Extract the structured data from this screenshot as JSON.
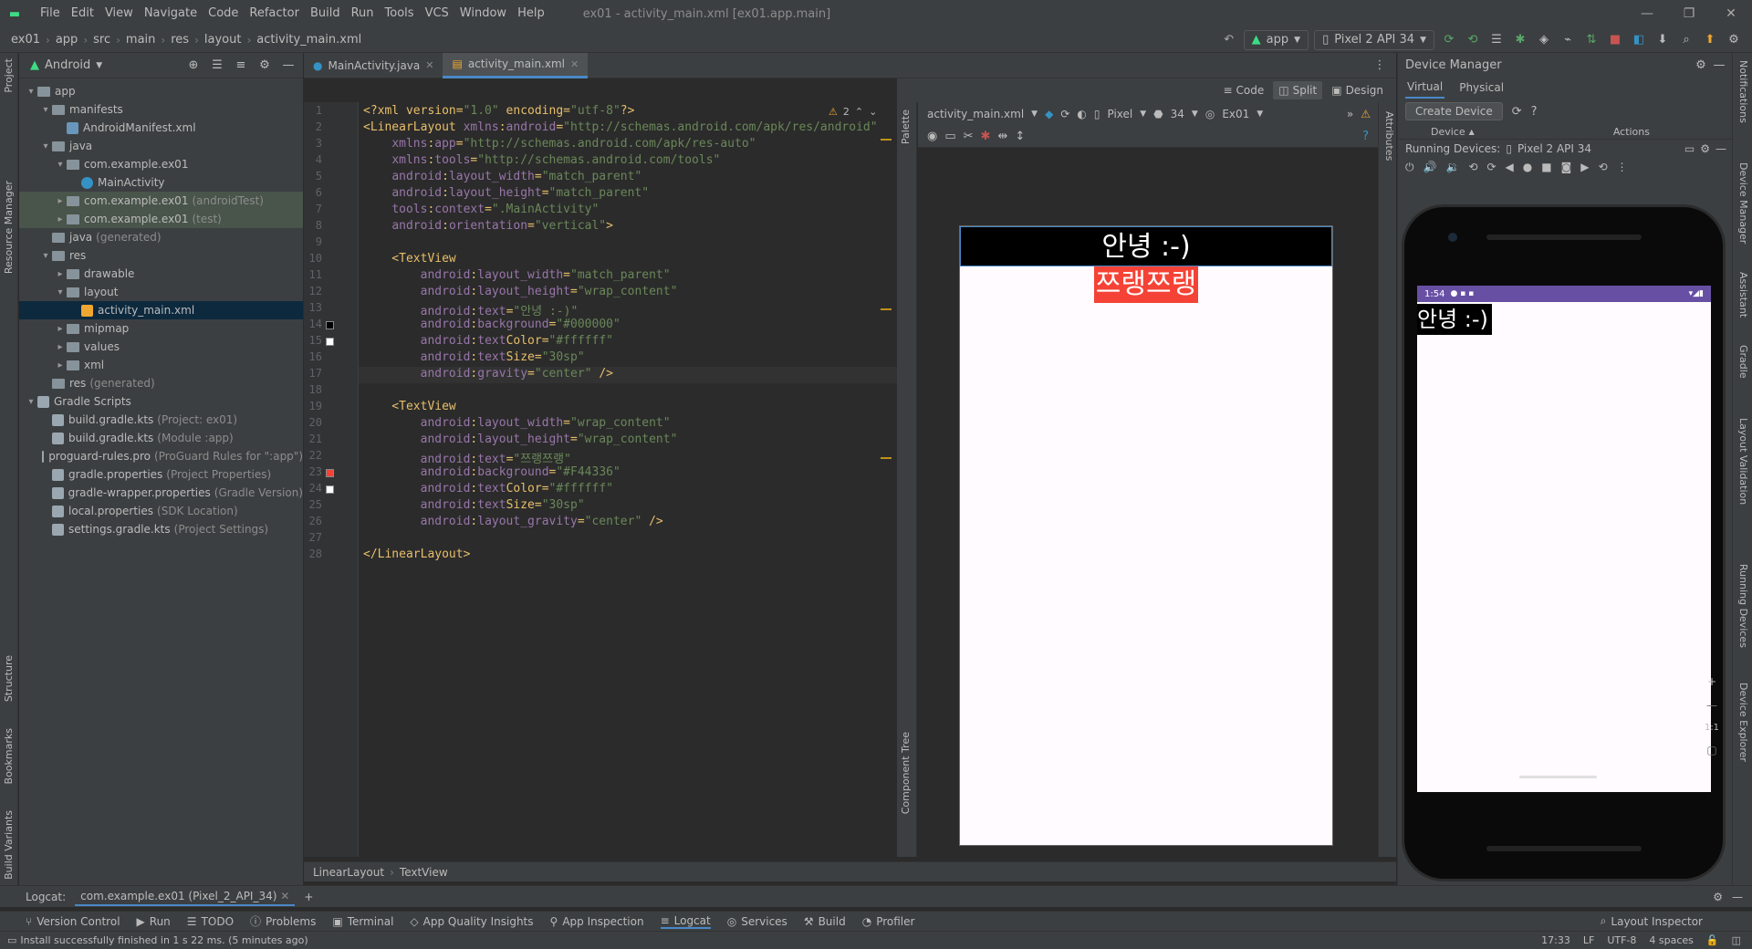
{
  "menubar": {
    "items": [
      "File",
      "Edit",
      "View",
      "Navigate",
      "Code",
      "Refactor",
      "Build",
      "Run",
      "Tools",
      "VCS",
      "Window",
      "Help"
    ],
    "title": "ex01 - activity_main.xml [ex01.app.main]"
  },
  "navbar": {
    "crumbs": [
      "ex01",
      "app",
      "src",
      "main",
      "res",
      "layout",
      "activity_main.xml"
    ],
    "run_config": "app",
    "device": "Pixel 2 API 34"
  },
  "project": {
    "view": "Android",
    "tree": [
      {
        "label": "app",
        "extra": "",
        "indent": 0,
        "kind": "folder",
        "arrow": "▾"
      },
      {
        "label": "manifests",
        "extra": "",
        "indent": 1,
        "kind": "folder",
        "arrow": "▾"
      },
      {
        "label": "AndroidManifest.xml",
        "extra": "",
        "indent": 2,
        "kind": "manifest",
        "arrow": ""
      },
      {
        "label": "java",
        "extra": "",
        "indent": 1,
        "kind": "folder",
        "arrow": "▾"
      },
      {
        "label": "com.example.ex01",
        "extra": "",
        "indent": 2,
        "kind": "folder",
        "arrow": "▾"
      },
      {
        "label": "MainActivity",
        "extra": "",
        "indent": 3,
        "kind": "class",
        "arrow": ""
      },
      {
        "label": "com.example.ex01",
        "extra": "(androidTest)",
        "indent": 2,
        "kind": "folder",
        "arrow": "▸",
        "hl": true
      },
      {
        "label": "com.example.ex01",
        "extra": "(test)",
        "indent": 2,
        "kind": "folder",
        "arrow": "▸",
        "hl": true
      },
      {
        "label": "java",
        "extra": "(generated)",
        "indent": 1,
        "kind": "folder",
        "arrow": ""
      },
      {
        "label": "res",
        "extra": "",
        "indent": 1,
        "kind": "folder",
        "arrow": "▾"
      },
      {
        "label": "drawable",
        "extra": "",
        "indent": 2,
        "kind": "folder",
        "arrow": "▸"
      },
      {
        "label": "layout",
        "extra": "",
        "indent": 2,
        "kind": "folder",
        "arrow": "▾"
      },
      {
        "label": "activity_main.xml",
        "extra": "",
        "indent": 3,
        "kind": "layoutfile",
        "arrow": "",
        "selected": true
      },
      {
        "label": "mipmap",
        "extra": "",
        "indent": 2,
        "kind": "folder",
        "arrow": "▸"
      },
      {
        "label": "values",
        "extra": "",
        "indent": 2,
        "kind": "folder",
        "arrow": "▸"
      },
      {
        "label": "xml",
        "extra": "",
        "indent": 2,
        "kind": "folder",
        "arrow": "▸"
      },
      {
        "label": "res",
        "extra": "(generated)",
        "indent": 1,
        "kind": "folder",
        "arrow": ""
      },
      {
        "label": "Gradle Scripts",
        "extra": "",
        "indent": 0,
        "kind": "gradle",
        "arrow": "▾"
      },
      {
        "label": "build.gradle.kts",
        "extra": "(Project: ex01)",
        "indent": 1,
        "kind": "gradle",
        "arrow": ""
      },
      {
        "label": "build.gradle.kts",
        "extra": "(Module :app)",
        "indent": 1,
        "kind": "gradle",
        "arrow": ""
      },
      {
        "label": "proguard-rules.pro",
        "extra": "(ProGuard Rules for \":app\")",
        "indent": 1,
        "kind": "file",
        "arrow": ""
      },
      {
        "label": "gradle.properties",
        "extra": "(Project Properties)",
        "indent": 1,
        "kind": "file",
        "arrow": ""
      },
      {
        "label": "gradle-wrapper.properties",
        "extra": "(Gradle Version)",
        "indent": 1,
        "kind": "file",
        "arrow": ""
      },
      {
        "label": "local.properties",
        "extra": "(SDK Location)",
        "indent": 1,
        "kind": "file",
        "arrow": ""
      },
      {
        "label": "settings.gradle.kts",
        "extra": "(Project Settings)",
        "indent": 1,
        "kind": "gradle",
        "arrow": ""
      }
    ]
  },
  "left_strip": [
    "Project",
    "Resource Manager",
    "Structure",
    "Bookmarks",
    "Build Variants"
  ],
  "right_strip": [
    "Notifications",
    "Device Manager",
    "Assistant",
    "Gradle",
    "Layout Validation",
    "Running Devices",
    "Device Explorer"
  ],
  "editor": {
    "tabs": [
      {
        "label": "MainActivity.java",
        "active": false
      },
      {
        "label": "activity_main.xml",
        "active": true
      }
    ],
    "warnings": "2",
    "lines": [
      "<?xml version=\"1.0\" encoding=\"utf-8\"?>",
      "<LinearLayout xmlns:android=\"http://schemas.android.com/apk/res/android\"",
      "    xmlns:app=\"http://schemas.android.com/apk/res-auto\"",
      "    xmlns:tools=\"http://schemas.android.com/tools\"",
      "    android:layout_width=\"match_parent\"",
      "    android:layout_height=\"match_parent\"",
      "    tools:context=\".MainActivity\"",
      "    android:orientation=\"vertical\">",
      "",
      "    <TextView",
      "        android:layout_width=\"match_parent\"",
      "        android:layout_height=\"wrap_content\"",
      "        android:text=\"안녕 :-)\"",
      "        android:background=\"#000000\"",
      "        android:textColor=\"#ffffff\"",
      "        android:textSize=\"30sp\"",
      "        android:gravity=\"center\" />",
      "",
      "    <TextView",
      "        android:layout_width=\"wrap_content\"",
      "        android:layout_height=\"wrap_content\"",
      "        android:text=\"쯔랭쯔랭\"",
      "        android:background=\"#F44336\"",
      "        android:textColor=\"#ffffff\"",
      "        android:textSize=\"30sp\"",
      "        android:layout_gravity=\"center\" />",
      "",
      "</LinearLayout>"
    ],
    "current_line": 17,
    "color_swatches": [
      {
        "line": 14,
        "color": "#000000"
      },
      {
        "line": 15,
        "color": "#ffffff"
      },
      {
        "line": 23,
        "color": "#F44336"
      },
      {
        "line": 24,
        "color": "#ffffff"
      }
    ]
  },
  "view_modes": [
    "Code",
    "Split",
    "Design"
  ],
  "design": {
    "file": "activity_main.xml",
    "device": "Pixel",
    "api": "34",
    "theme": "Ex01",
    "palette_label": "Palette",
    "component_tree_label": "Component Tree",
    "attributes_label": "Attributes",
    "tv1_text": "안녕 :-)",
    "tv2_text": "쯔랭쯔랭"
  },
  "device_manager": {
    "title": "Device Manager",
    "tabs": [
      "Virtual",
      "Physical"
    ],
    "create_button": "Create Device",
    "col_device": "Device",
    "col_actions": "Actions",
    "running_label": "Running Devices:",
    "running_device": "Pixel 2 API 34",
    "emu_time": "1:54",
    "emu_text": "안녕 :-)",
    "zoom_label": "1:1"
  },
  "breadcrumbs": [
    "LinearLayout",
    "TextView"
  ],
  "logcat": {
    "label": "Logcat:",
    "tab": "com.example.ex01 (Pixel_2_API_34)"
  },
  "bottom_tabs": [
    "Version Control",
    "Run",
    "TODO",
    "Problems",
    "Terminal",
    "App Quality Insights",
    "App Inspection",
    "Logcat",
    "Services",
    "Build",
    "Profiler"
  ],
  "layout_inspector": "Layout Inspector",
  "status": {
    "message": "Install successfully finished in 1 s 22 ms. (5 minutes ago)",
    "position": "17:33",
    "line_sep": "LF",
    "encoding": "UTF-8",
    "indent": "4 spaces"
  }
}
